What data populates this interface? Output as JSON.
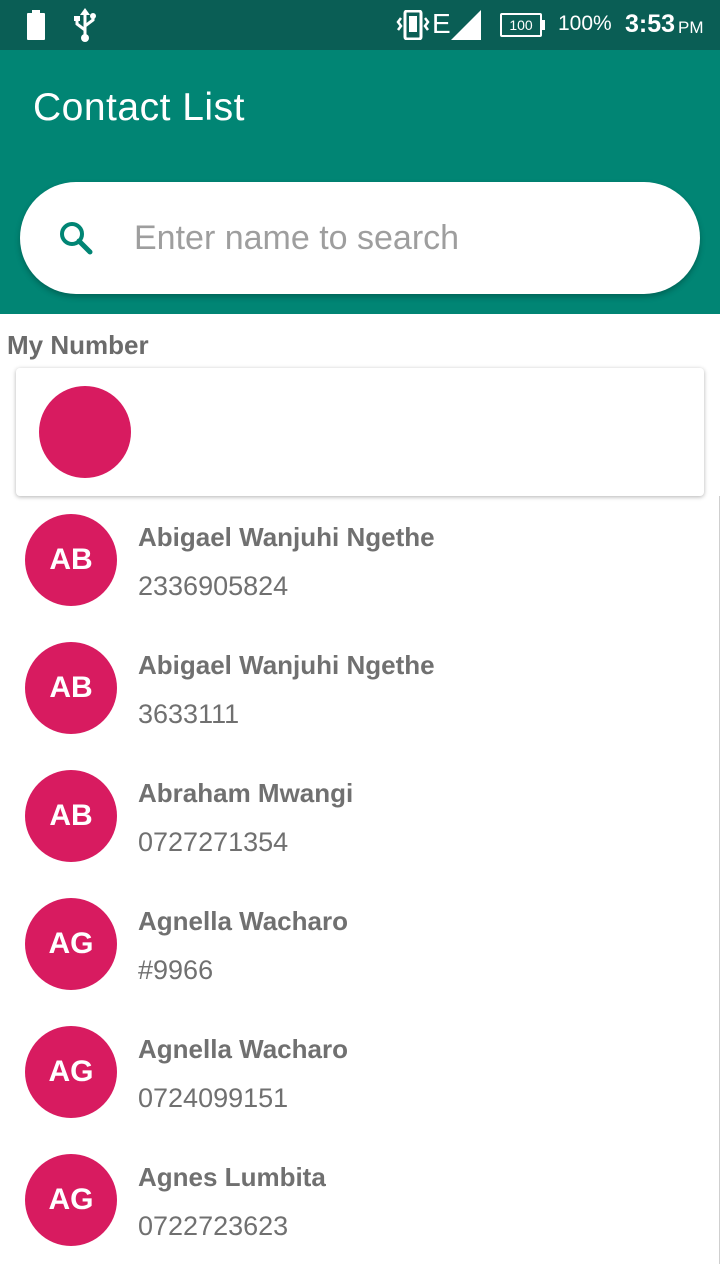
{
  "status_bar": {
    "battery_percent": "100%",
    "battery_badge": "100",
    "network_type": "E",
    "time": "3:53",
    "ampm": "PM",
    "icons": [
      "battery-icon",
      "usb-icon",
      "vibrate-icon",
      "signal-icon",
      "battery-level-icon"
    ]
  },
  "app_bar": {
    "title": "Contact List"
  },
  "search": {
    "placeholder": "Enter name to search",
    "value": ""
  },
  "my_number": {
    "label": "My Number"
  },
  "colors": {
    "primary": "#018574",
    "status_bar": "#0a5e55",
    "avatar": "#d81b60"
  },
  "contacts": [
    {
      "initials": "AB",
      "name": "Abigael Wanjuhi Ngethe",
      "number": "2336905824"
    },
    {
      "initials": "AB",
      "name": "Abigael Wanjuhi Ngethe",
      "number": "3633111"
    },
    {
      "initials": "AB",
      "name": "Abraham Mwangi",
      "number": "0727271354"
    },
    {
      "initials": "AG",
      "name": "Agnella Wacharo",
      "number": "#9966"
    },
    {
      "initials": "AG",
      "name": "Agnella Wacharo",
      "number": "0724099151"
    },
    {
      "initials": "AG",
      "name": "Agnes Lumbita",
      "number": "0722723623"
    }
  ]
}
